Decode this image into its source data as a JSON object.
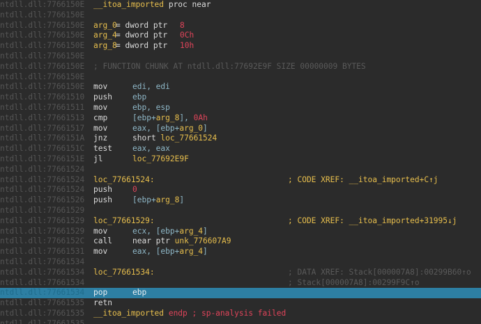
{
  "lines": [
    {
      "addr": "ntdll.dll:7766150E",
      "label": "__itoa_imported",
      "rest": "proc near"
    },
    {
      "addr": "ntdll.dll:7766150E"
    },
    {
      "addr": "ntdll.dll:7766150E",
      "argname": "arg_0",
      "argtype": "= dword ptr",
      "argval": "8"
    },
    {
      "addr": "ntdll.dll:7766150E",
      "argname": "arg_4",
      "argtype": "= dword ptr",
      "argval": "0Ch"
    },
    {
      "addr": "ntdll.dll:7766150E",
      "argname": "arg_8",
      "argtype": "= dword ptr",
      "argval": "10h"
    },
    {
      "addr": "ntdll.dll:7766150E"
    },
    {
      "addr": "ntdll.dll:7766150E",
      "comment": "; FUNCTION CHUNK AT ntdll.dll:77692E9F SIZE 00000009 BYTES"
    },
    {
      "addr": "ntdll.dll:7766150E"
    },
    {
      "addr": "ntdll.dll:7766150E",
      "mnem": "mov",
      "ops": [
        "edi, edi"
      ]
    },
    {
      "addr": "ntdll.dll:77661510",
      "mnem": "push",
      "ops": [
        "ebp"
      ]
    },
    {
      "addr": "ntdll.dll:77661511",
      "mnem": "mov",
      "ops": [
        "ebp, esp"
      ]
    },
    {
      "addr": "ntdll.dll:77661513",
      "mnem": "cmp",
      "ops": [
        "[ebp+",
        "arg_8",
        "], ",
        "0Ah"
      ]
    },
    {
      "addr": "ntdll.dll:77661517",
      "mnem": "mov",
      "ops": [
        "eax, [ebp+",
        "arg_0",
        "]"
      ]
    },
    {
      "addr": "ntdll.dll:7766151A",
      "mnem": "jnz",
      "ops": [
        "short ",
        "loc_77661524"
      ]
    },
    {
      "addr": "ntdll.dll:7766151C",
      "mnem": "test",
      "ops": [
        "eax, eax"
      ]
    },
    {
      "addr": "ntdll.dll:7766151E",
      "mnem": "jl",
      "ops": [
        "",
        "loc_77692E9F"
      ]
    },
    {
      "addr": "ntdll.dll:77661524"
    },
    {
      "addr": "ntdll.dll:77661524",
      "loclabel": "loc_77661524:",
      "xref": "; CODE XREF: __itoa_imported+C↑j"
    },
    {
      "addr": "ntdll.dll:77661524",
      "mnem": "push",
      "ops": [
        "",
        "",
        "",
        "0"
      ]
    },
    {
      "addr": "ntdll.dll:77661526",
      "mnem": "push",
      "ops": [
        "[ebp+",
        "arg_8",
        "]"
      ]
    },
    {
      "addr": "ntdll.dll:77661529"
    },
    {
      "addr": "ntdll.dll:77661529",
      "loclabel": "loc_77661529:",
      "xref": "; CODE XREF: __itoa_imported+31995↓j"
    },
    {
      "addr": "ntdll.dll:77661529",
      "mnem": "mov",
      "ops": [
        "ecx, [ebp+",
        "arg_4",
        "]"
      ]
    },
    {
      "addr": "ntdll.dll:7766152C",
      "mnem": "call",
      "ops": [
        "near ptr ",
        "unk_776607A9"
      ]
    },
    {
      "addr": "ntdll.dll:77661531",
      "mnem": "mov",
      "ops": [
        "eax, [ebp+",
        "arg_4",
        "]"
      ]
    },
    {
      "addr": "ntdll.dll:77661534"
    },
    {
      "addr": "ntdll.dll:77661534",
      "loclabel": "loc_77661534:",
      "cmt2": "; DATA XREF: Stack[000007A8]:00299B60↑o"
    },
    {
      "addr": "ntdll.dll:77661534",
      "cmt2": "; Stack[000007A8]:00299F9C↑o"
    },
    {
      "addr": "ntdll.dll:77661534",
      "mnem": "pop",
      "ops": [
        "ebp"
      ],
      "selected": true
    },
    {
      "addr": "ntdll.dll:77661535",
      "mnem": "retn",
      "ops": []
    },
    {
      "addr": "ntdll.dll:77661535",
      "label": "__itoa_imported",
      "endp": "endp ; sp-analysis failed"
    },
    {
      "addr": "ntdll.dll:77661535"
    }
  ],
  "colors": {
    "background": "#2b2b2b",
    "selection": "#2d7fa3",
    "label": "#e8bf4d",
    "number": "#e0445a"
  }
}
